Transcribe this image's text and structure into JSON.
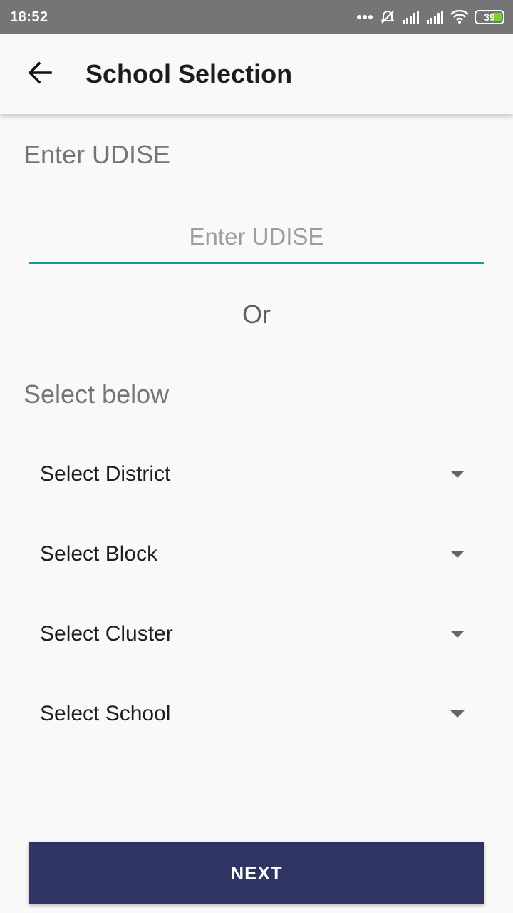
{
  "status_bar": {
    "time": "18:52",
    "battery": "39",
    "battery_color": "#7ed321",
    "icons": [
      "more-dots-icon",
      "alarm-off-icon",
      "signal-icon",
      "signal-icon",
      "wifi-icon",
      "battery-icon"
    ]
  },
  "app_bar": {
    "title": "School Selection",
    "back_icon": "arrow-back-icon"
  },
  "udise_section": {
    "label": "Enter UDISE",
    "input_value": "",
    "input_placeholder": "Enter UDISE",
    "underline_color": "#1a9a8a"
  },
  "or_label": "Or",
  "select_section": {
    "label": "Select below",
    "dropdowns": [
      {
        "label": "Select District"
      },
      {
        "label": "Select Block"
      },
      {
        "label": "Select Cluster"
      },
      {
        "label": "Select School"
      }
    ]
  },
  "next_button": {
    "label": "NEXT",
    "color": "#2f3563"
  }
}
